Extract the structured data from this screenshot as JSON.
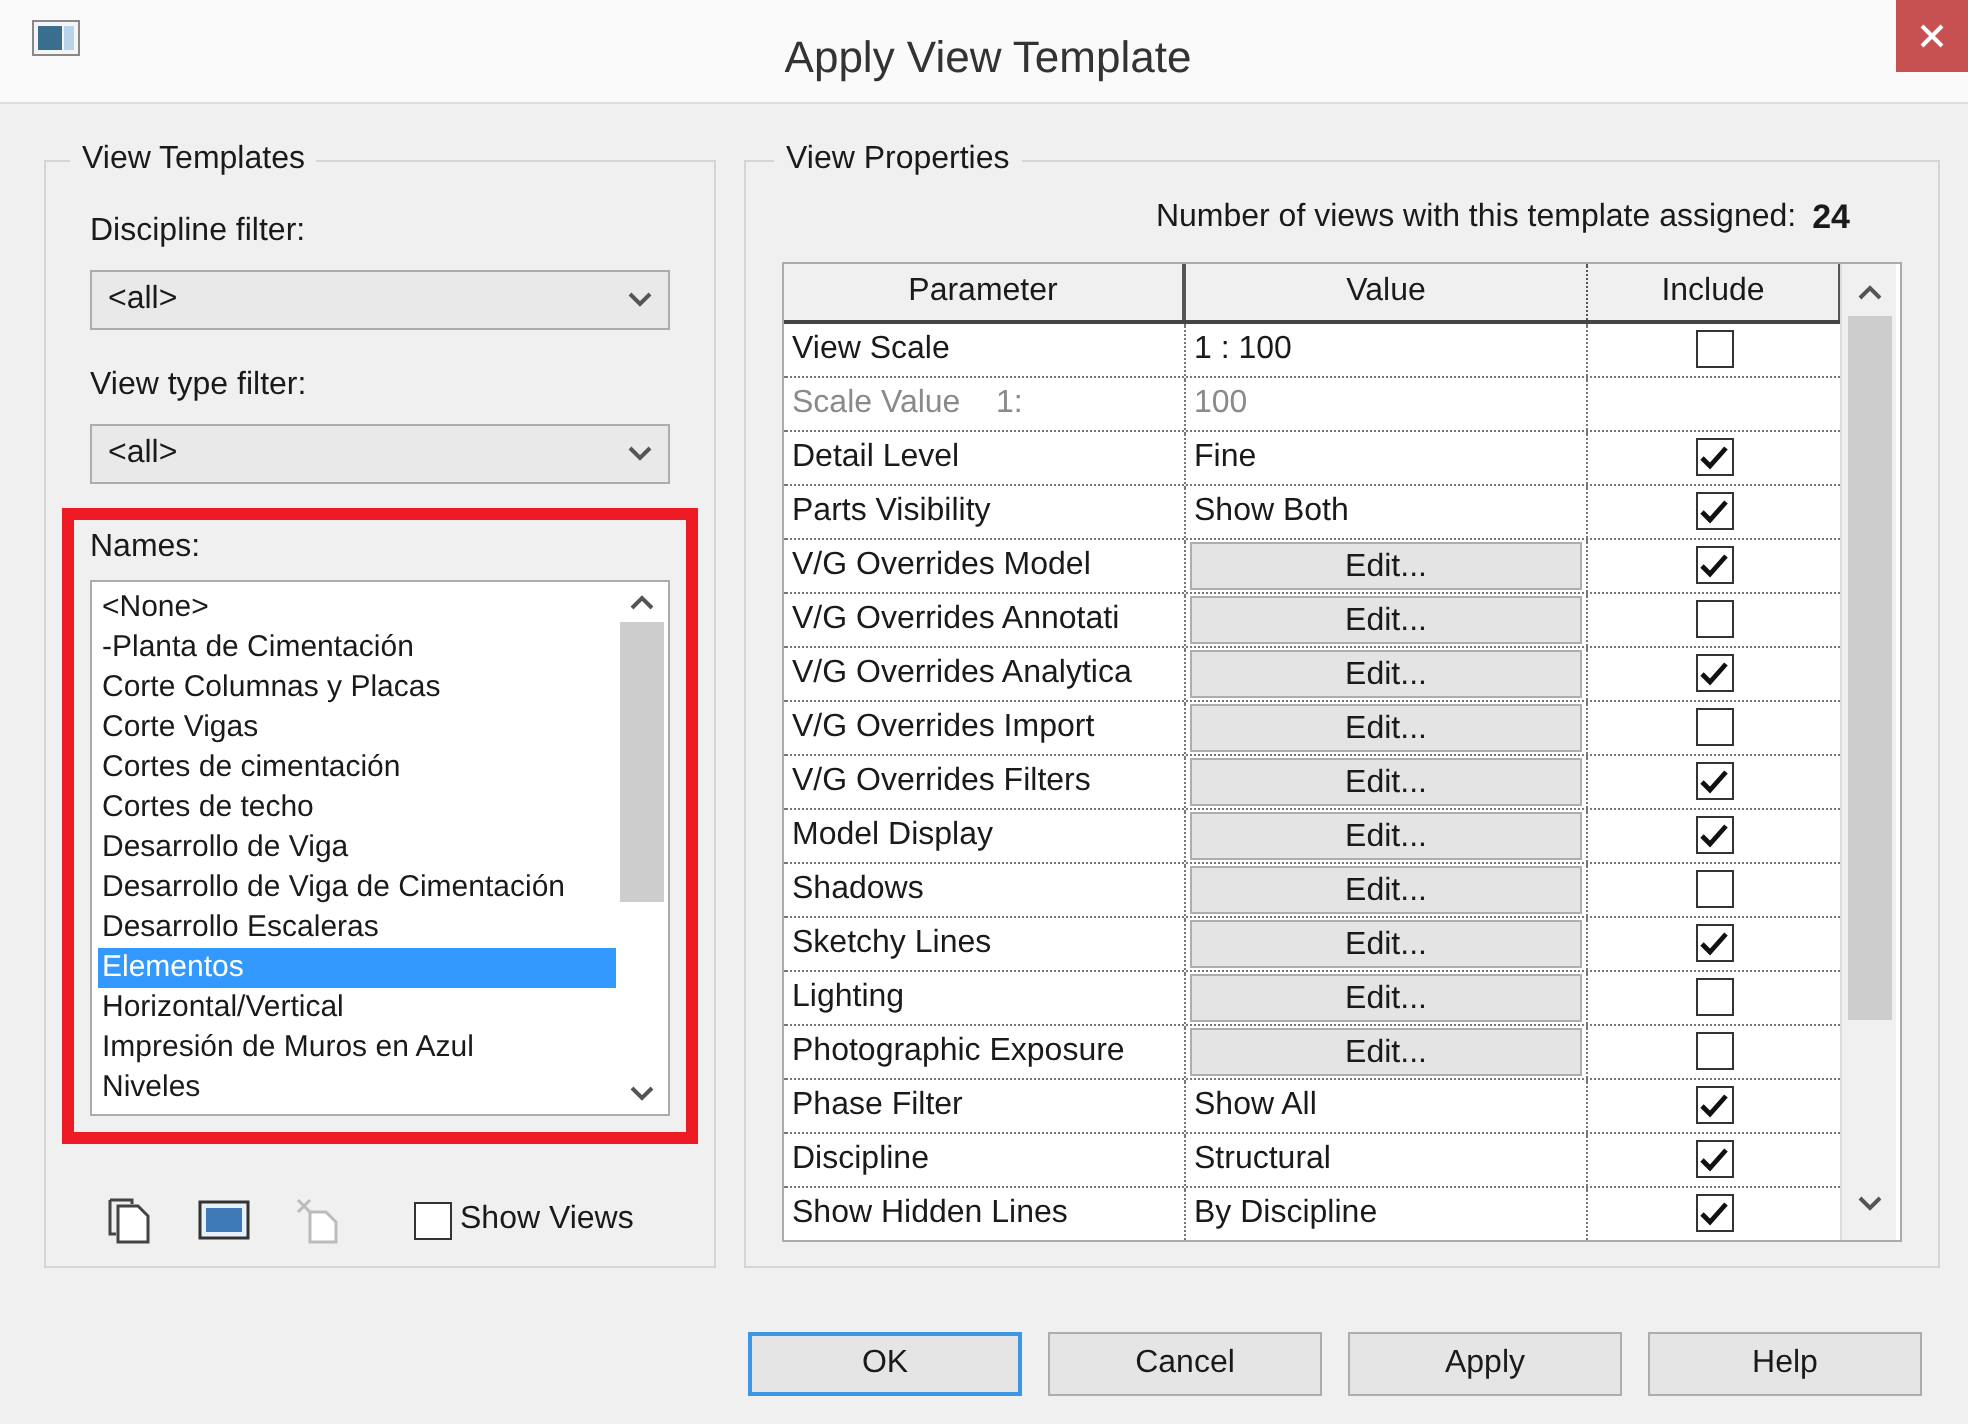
{
  "window": {
    "title": "Apply View Template"
  },
  "view_templates": {
    "title": "View Templates",
    "discipline_filter": {
      "label": "Discipline filter:",
      "value": "<all>"
    },
    "view_type_filter": {
      "label": "View type filter:",
      "value": "<all>"
    },
    "names": {
      "label": "Names:",
      "highlighted": true,
      "items": [
        {
          "label": "<None>",
          "selected": false
        },
        {
          "label": "-Planta de Cimentación",
          "selected": false
        },
        {
          "label": "Corte Columnas y Placas",
          "selected": false
        },
        {
          "label": "Corte Vigas",
          "selected": false
        },
        {
          "label": "Cortes de cimentación",
          "selected": false
        },
        {
          "label": "Cortes de techo",
          "selected": false
        },
        {
          "label": "Desarrollo de Viga",
          "selected": false
        },
        {
          "label": "Desarrollo de Viga de Cimentación",
          "selected": false
        },
        {
          "label": "Desarrollo Escaleras",
          "selected": false
        },
        {
          "label": "Elementos",
          "selected": true
        },
        {
          "label": "Horizontal/Vertical",
          "selected": false
        },
        {
          "label": "Impresión de Muros en Azul",
          "selected": false
        },
        {
          "label": "Niveles",
          "selected": false
        }
      ]
    },
    "show_views": {
      "label": "Show Views",
      "checked": false
    }
  },
  "view_properties": {
    "title": "View Properties",
    "count_label": "Number of views with this template assigned:",
    "count": "24",
    "columns": [
      "Parameter",
      "Value",
      "Include"
    ],
    "rows": [
      {
        "kind": "value",
        "parameter": "View Scale",
        "value": "1 : 100",
        "checked": false
      },
      {
        "kind": "derived",
        "parameter": "Scale Value    1:",
        "value": "100"
      },
      {
        "kind": "value",
        "parameter": "Detail Level",
        "value": "Fine",
        "checked": true
      },
      {
        "kind": "value",
        "parameter": "Parts Visibility",
        "value": "Show Both",
        "checked": true
      },
      {
        "kind": "edit",
        "parameter": "V/G Overrides Model",
        "value": "Edit...",
        "checked": true
      },
      {
        "kind": "edit",
        "parameter": "V/G Overrides Annotati",
        "value": "Edit...",
        "checked": false
      },
      {
        "kind": "edit",
        "parameter": "V/G Overrides Analytica",
        "value": "Edit...",
        "checked": true
      },
      {
        "kind": "edit",
        "parameter": "V/G Overrides Import",
        "value": "Edit...",
        "checked": false
      },
      {
        "kind": "edit",
        "parameter": "V/G Overrides Filters",
        "value": "Edit...",
        "checked": true
      },
      {
        "kind": "edit",
        "parameter": "Model Display",
        "value": "Edit...",
        "checked": true
      },
      {
        "kind": "edit",
        "parameter": "Shadows",
        "value": "Edit...",
        "checked": false
      },
      {
        "kind": "edit",
        "parameter": "Sketchy Lines",
        "value": "Edit...",
        "checked": true
      },
      {
        "kind": "edit",
        "parameter": "Lighting",
        "value": "Edit...",
        "checked": false
      },
      {
        "kind": "edit",
        "parameter": "Photographic Exposure",
        "value": "Edit...",
        "checked": false
      },
      {
        "kind": "value",
        "parameter": "Phase Filter",
        "value": "Show All",
        "checked": true
      },
      {
        "kind": "value",
        "parameter": "Discipline",
        "value": "Structural",
        "checked": true
      },
      {
        "kind": "value",
        "parameter": "Show Hidden Lines",
        "value": "By Discipline",
        "checked": true
      }
    ]
  },
  "buttons": [
    {
      "label": "OK",
      "default": true
    },
    {
      "label": "Cancel",
      "default": false
    },
    {
      "label": "Apply",
      "default": false
    },
    {
      "label": "Help",
      "default": false
    }
  ]
}
